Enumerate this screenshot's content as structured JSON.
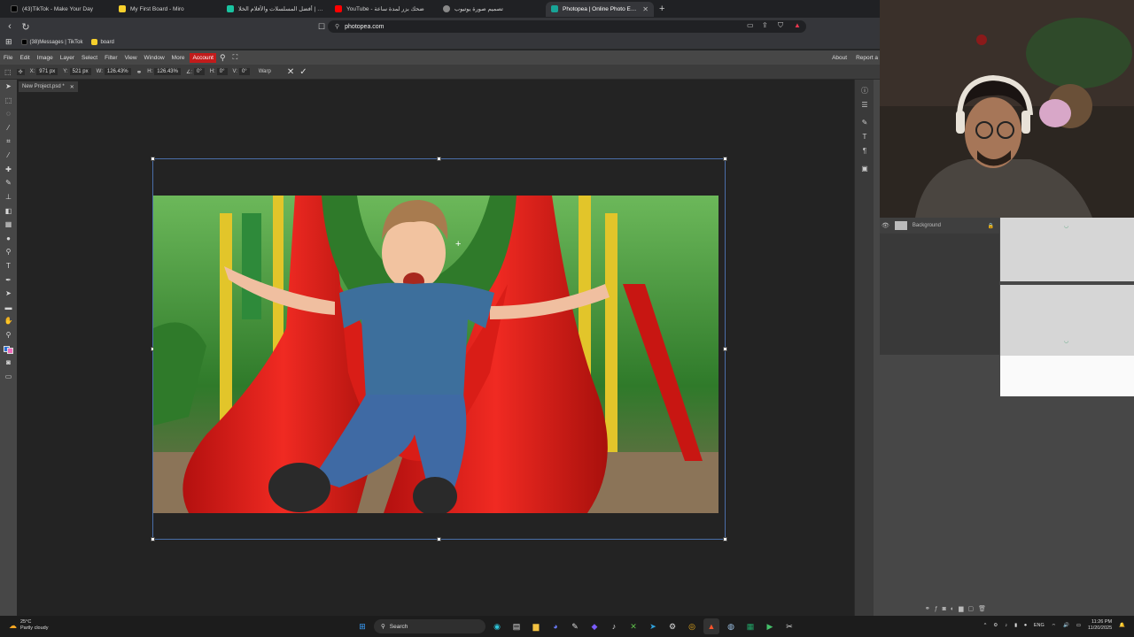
{
  "browser": {
    "tabs": [
      {
        "label": "(43)TikTok - Make Your Day",
        "color": "#000000",
        "active": false
      },
      {
        "label": "My First Board - Miro",
        "color": "#f7d02c",
        "active": false
      },
      {
        "label": "شاهد | أفضل المسلسلات والأفلام الخلا...",
        "color": "#19c3a0",
        "active": false
      },
      {
        "label": "YouTube - ضحك بزر لمدة ساعة",
        "color": "#ff0000",
        "active": false
      },
      {
        "label": "تصميم صورة يوتيوب",
        "color": "#888888",
        "active": false
      },
      {
        "label": "Photopea | Online Photo Editor",
        "color": "#18a497",
        "active": true
      }
    ],
    "new_tab_label": "+",
    "url": "photopea.com",
    "bookmarks": [
      {
        "label": "(38)Messages | TikTok",
        "color": "#000000"
      },
      {
        "label": "board",
        "color": "#f7d02c"
      }
    ]
  },
  "menubar": {
    "items": [
      "File",
      "Edit",
      "Image",
      "Layer",
      "Select",
      "Filter",
      "View",
      "Window",
      "More"
    ],
    "account": "Account",
    "right_items": [
      "About",
      "Report a"
    ]
  },
  "options": {
    "x_label": "X:",
    "x_value": "971 px",
    "y_label": "Y:",
    "y_value": "521 px",
    "w_label": "W:",
    "w_value": "126.43%",
    "h_label": "H:",
    "h_value": "126.43%",
    "angle_label": "∠:",
    "angle_value": "0°",
    "hskew_label": "H:",
    "hskew_value": "0°",
    "vskew_label": "V:",
    "vskew_value": "0°",
    "warp_label": "Warp"
  },
  "document": {
    "tab_label": "New Project.psd *"
  },
  "layers": {
    "background_label": "Background"
  },
  "taskbar": {
    "temperature": "25°C",
    "weather": "Partly cloudy",
    "search_label": "Search",
    "lang": "ENG",
    "time": "11:26 PM",
    "date": "11/20/2025"
  }
}
